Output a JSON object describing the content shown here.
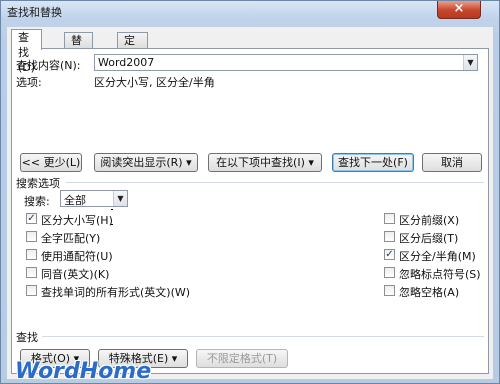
{
  "window": {
    "title": "查找和替换",
    "close_glyph": "×"
  },
  "tabs": [
    {
      "label": "查找(D)",
      "active": true
    },
    {
      "label": "替换(P)",
      "active": false
    },
    {
      "label": "定位(G)",
      "active": false
    }
  ],
  "find": {
    "label": "查找内容(N):",
    "value": "Word2007",
    "options_label": "选项:",
    "options_value": "区分大小写, 区分全/半角"
  },
  "buttons": {
    "less": "<< 更少(L)",
    "reading_highlight": "阅读突出显示(R) ▾",
    "find_in": "在以下项中查找(I) ▾",
    "find_next": "查找下一处(F)",
    "cancel": "取消"
  },
  "search_options": {
    "title": "搜索选项",
    "search_label": "搜索:",
    "search_value": "全部",
    "left": [
      {
        "label": "区分大小写(H)",
        "checked": true
      },
      {
        "label": "全字匹配(Y)",
        "checked": false
      },
      {
        "label": "使用通配符(U)",
        "checked": false
      },
      {
        "label": "同音(英文)(K)",
        "checked": false
      },
      {
        "label": "查找单词的所有形式(英文)(W)",
        "checked": false
      }
    ],
    "right": [
      {
        "label": "区分前缀(X)",
        "checked": false
      },
      {
        "label": "区分后缀(T)",
        "checked": false
      },
      {
        "label": "区分全/半角(M)",
        "checked": true
      },
      {
        "label": "忽略标点符号(S)",
        "checked": false
      },
      {
        "label": "忽略空格(A)",
        "checked": false
      }
    ]
  },
  "find_section": {
    "title": "查找",
    "format": "格式(O) ▾",
    "special": "特殊格式(E) ▾",
    "no_format": "不限定格式(T)"
  },
  "watermark": "WordHome"
}
